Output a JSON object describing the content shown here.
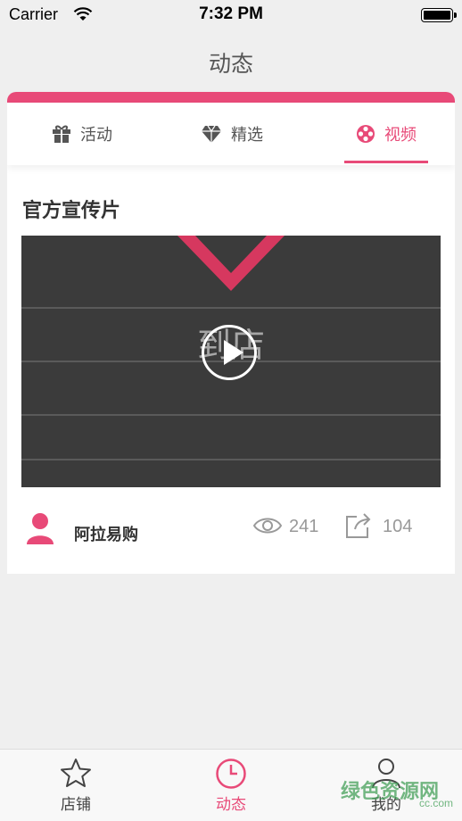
{
  "status_bar": {
    "carrier": "Carrier",
    "time": "7:32 PM"
  },
  "nav": {
    "title": "动态"
  },
  "tabs": [
    {
      "label": "活动",
      "icon": "gift-icon"
    },
    {
      "label": "精选",
      "icon": "diamond-icon"
    },
    {
      "label": "视频",
      "icon": "film-reel-icon",
      "active": true
    }
  ],
  "post": {
    "title": "官方宣传片",
    "video_overlay_text": "到店",
    "author": "阿拉易购",
    "views": "241",
    "shares": "104"
  },
  "tabbar": [
    {
      "label": "店铺",
      "icon": "star-icon"
    },
    {
      "label": "动态",
      "icon": "clock-icon",
      "active": true
    },
    {
      "label": "我的",
      "icon": "user-icon"
    }
  ],
  "watermark": {
    "text": "绿色资源网",
    "sub": "cc.com"
  },
  "colors": {
    "accent": "#e84a78",
    "background": "#efefef"
  }
}
